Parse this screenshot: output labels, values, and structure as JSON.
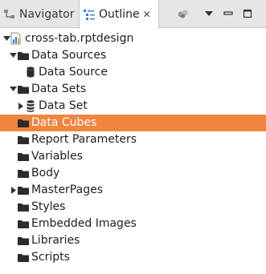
{
  "tabs": {
    "navigator": {
      "label": "Navigator",
      "icon": "navigator-icon"
    },
    "outline": {
      "label": "Outline",
      "icon": "outline-icon",
      "close": "✕"
    }
  },
  "toolbar": {
    "icons": [
      "link-icon",
      "view-menu-icon",
      "minimize-icon",
      "maximize-icon"
    ]
  },
  "tree": {
    "root": {
      "label": "cross-tab.rptdesign",
      "icon": "report-design-icon",
      "expanded": true
    },
    "data_sources": {
      "label": "Data Sources",
      "expanded": true
    },
    "data_source": {
      "label": "Data Source",
      "icon": "database-icon"
    },
    "data_sets": {
      "label": "Data Sets",
      "expanded": true
    },
    "data_set": {
      "label": "Data Set",
      "icon": "dataset-icon",
      "expanded": false
    },
    "data_cubes": {
      "label": "Data Cubes",
      "selected": true
    },
    "report_parameters": {
      "label": "Report Parameters"
    },
    "variables": {
      "label": "Variables"
    },
    "body": {
      "label": "Body"
    },
    "master_pages": {
      "label": "MasterPages",
      "expanded": false
    },
    "styles": {
      "label": "Styles"
    },
    "embedded_images": {
      "label": "Embedded Images"
    },
    "libraries": {
      "label": "Libraries"
    },
    "scripts": {
      "label": "Scripts"
    }
  },
  "colors": {
    "selection": "#ee8540",
    "folder": "#2b2b2b",
    "report_icon_blue": "#3c7dc4",
    "tab_bar": "#e6e6e6"
  }
}
